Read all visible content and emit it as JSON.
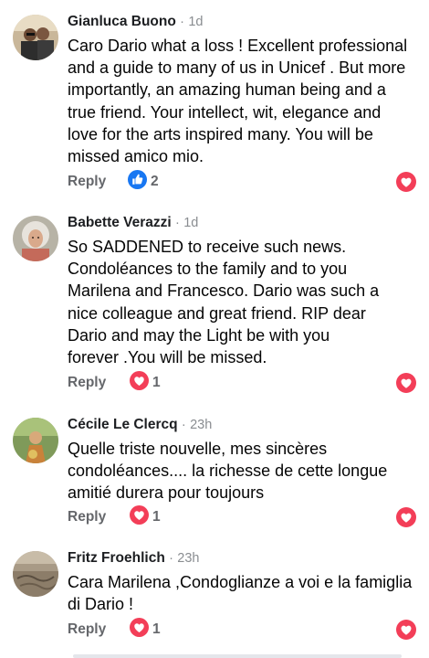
{
  "comments": [
    {
      "author": "Gianluca Buono",
      "time": "1d",
      "lines": [
        "Caro Dario what a loss ! Excellent professional",
        "and a guide to many of us in Unicef . But more",
        "importantly, an amazing human being and a",
        "true friend. Your intellect, wit, elegance and",
        "love for the arts inspired many. You will be",
        "missed amico mio."
      ],
      "reply_label": "Reply",
      "reaction_icon": "like-icon",
      "reaction_count": "2"
    },
    {
      "author": "Babette Verazzi",
      "time": "1d",
      "lines": [
        "So SADDENED to receive such news.",
        "Condoléances to the family and to you",
        "Marilena and Francesco. Dario was such a",
        "nice colleague  and great  friend.  RIP dear",
        "Dario and may the Light be with you",
        "forever .You will be missed."
      ],
      "reply_label": "Reply",
      "reaction_icon": "love-icon",
      "reaction_count": "1"
    },
    {
      "author": "Cécile Le Clercq",
      "time": "23h",
      "lines": [
        "Quelle triste nouvelle, mes sincères",
        "condoléances.... la richesse de cette  longue",
        "amitié durera pour toujours"
      ],
      "reply_label": "Reply",
      "reaction_icon": "love-icon",
      "reaction_count": "1"
    },
    {
      "author": "Fritz Froehlich",
      "time": "23h",
      "lines": [
        "Cara Marilena ,Condoglianze a voi e la famiglia",
        "di Dario !"
      ],
      "reply_label": "Reply",
      "reaction_icon": "love-icon",
      "reaction_count": "1"
    }
  ],
  "separator": "·",
  "colors": {
    "like_blue": "#1877f2",
    "love_red": "#f33e58",
    "meta_gray": "#65676b"
  }
}
